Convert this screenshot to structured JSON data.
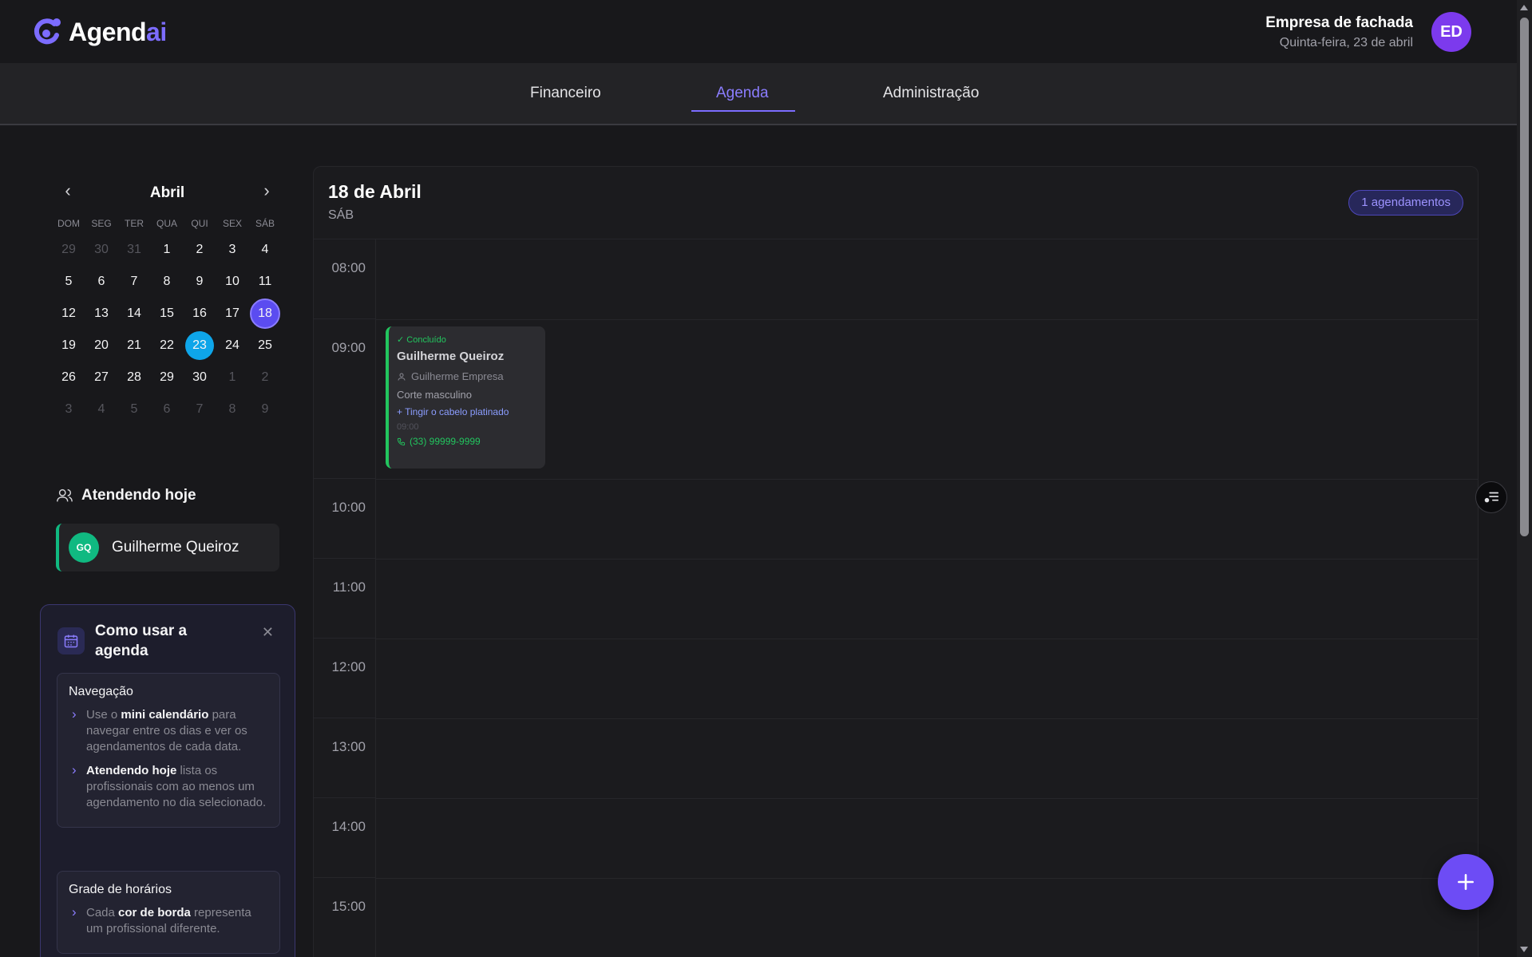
{
  "header": {
    "logo_main": "Agend",
    "logo_accent": "ai",
    "company_name": "Empresa de fachada",
    "date": "Quinta-feira, 23 de abril",
    "avatar_initials": "ED"
  },
  "nav": {
    "tabs": [
      {
        "label": "Financeiro",
        "active": false
      },
      {
        "label": "Agenda",
        "active": true
      },
      {
        "label": "Administração",
        "active": false
      }
    ]
  },
  "mini_calendar": {
    "month": "Abril",
    "weekdays": [
      "DOM",
      "SEG",
      "TER",
      "QUA",
      "QUI",
      "SEX",
      "SÁB"
    ],
    "days": [
      {
        "n": "29",
        "muted": true
      },
      {
        "n": "30",
        "muted": true
      },
      {
        "n": "31",
        "muted": true
      },
      {
        "n": "1"
      },
      {
        "n": "2"
      },
      {
        "n": "3"
      },
      {
        "n": "4"
      },
      {
        "n": "5"
      },
      {
        "n": "6"
      },
      {
        "n": "7"
      },
      {
        "n": "8"
      },
      {
        "n": "9"
      },
      {
        "n": "10"
      },
      {
        "n": "11"
      },
      {
        "n": "12"
      },
      {
        "n": "13"
      },
      {
        "n": "14"
      },
      {
        "n": "15"
      },
      {
        "n": "16"
      },
      {
        "n": "17"
      },
      {
        "n": "18",
        "selected": true
      },
      {
        "n": "19"
      },
      {
        "n": "20"
      },
      {
        "n": "21"
      },
      {
        "n": "22"
      },
      {
        "n": "23",
        "today": true
      },
      {
        "n": "24"
      },
      {
        "n": "25"
      },
      {
        "n": "26"
      },
      {
        "n": "27"
      },
      {
        "n": "28"
      },
      {
        "n": "29"
      },
      {
        "n": "30"
      },
      {
        "n": "1",
        "muted": true
      },
      {
        "n": "2",
        "muted": true
      },
      {
        "n": "3",
        "muted": true
      },
      {
        "n": "4",
        "muted": true
      },
      {
        "n": "5",
        "muted": true
      },
      {
        "n": "6",
        "muted": true
      },
      {
        "n": "7",
        "muted": true
      },
      {
        "n": "8",
        "muted": true
      },
      {
        "n": "9",
        "muted": true
      }
    ]
  },
  "attending": {
    "title": "Atendendo hoje",
    "professionals": [
      {
        "initials": "GQ",
        "name": "Guilherme Queiroz",
        "color": "#10b981"
      }
    ]
  },
  "help": {
    "title": "Como usar a agenda",
    "sections": [
      {
        "heading": "Navegação",
        "bullets": [
          {
            "pre": "Use o ",
            "bold": "mini calendário",
            "post": " para navegar entre os dias e ver os agendamentos de cada data."
          },
          {
            "pre": "",
            "bold": "Atendendo hoje",
            "post": " lista os profissionais com ao menos um agendamento no dia selecionado."
          }
        ]
      },
      {
        "heading": "Grade de horários",
        "bullets": [
          {
            "pre": "Cada ",
            "bold": "cor de borda",
            "post": " representa um profissional diferente."
          }
        ]
      }
    ]
  },
  "agenda": {
    "date_title": "18 de Abril",
    "weekday": "SÁB",
    "count_badge": "1 agendamentos",
    "hours": [
      "08:00",
      "09:00",
      "10:00",
      "11:00",
      "12:00",
      "13:00",
      "14:00",
      "15:00"
    ],
    "appointment": {
      "status": "✓ Concluído",
      "name": "Guilherme Queiroz",
      "professional": "Guilherme Empresa",
      "service": "Corte masculino",
      "extra": "+ Tingir o cabelo platinado",
      "time": "09:00",
      "phone": "(33) 99999-9999",
      "border_color": "#22c55e"
    }
  },
  "colors": {
    "accent": "#7c6cff",
    "today": "#0ea5e9",
    "selected": "#5b4cf0",
    "success": "#22c55e"
  }
}
